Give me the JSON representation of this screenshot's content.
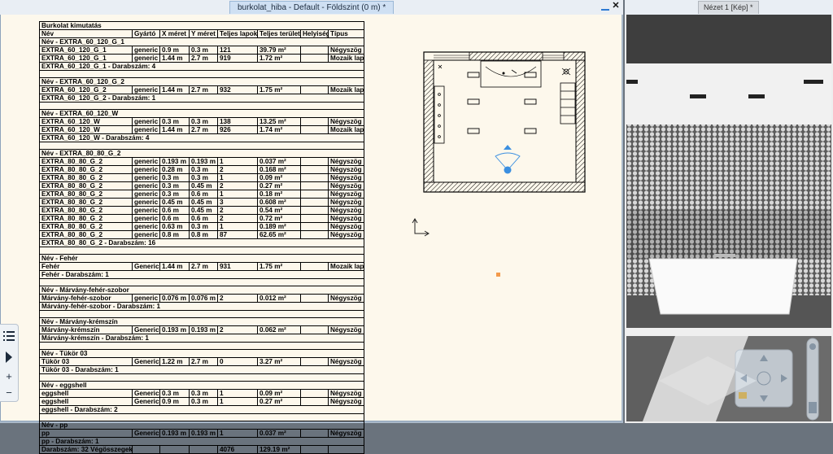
{
  "plan_window": {
    "tab_title": "burkolat_hiba - Default - Földszint (0 m) *",
    "minimize_label": "",
    "close_label": "✕"
  },
  "view_window": {
    "tab_title": "Nézet 1 [Kép] *"
  },
  "schedule": {
    "title": "Burkolat kimutatás",
    "headers": [
      "Név",
      "Gyártó",
      "X méret",
      "Y méret",
      "Teljes lapok",
      "Teljes terület",
      "Helyiség",
      "Típus"
    ],
    "rows": [
      {
        "kind": "group",
        "text": "Név - EXTRA_60_120_G_1"
      },
      {
        "kind": "data",
        "cells": [
          "EXTRA_60_120_G_1",
          "generic",
          "0.9 m",
          "0.3 m",
          "121",
          "39.79 m²",
          "",
          "Négyszög"
        ]
      },
      {
        "kind": "data",
        "cells": [
          "EXTRA_60_120_G_1",
          "generic",
          "1.44 m",
          "2.7 m",
          "919",
          "1.72 m²",
          "",
          "Mozaik lap"
        ]
      },
      {
        "kind": "summary",
        "text": "EXTRA_60_120_G_1 - Darabszám: 4"
      },
      {
        "kind": "gap"
      },
      {
        "kind": "group",
        "text": "Név - EXTRA_60_120_G_2"
      },
      {
        "kind": "data",
        "cells": [
          "EXTRA_60_120_G_2",
          "generic",
          "1.44 m",
          "2.7 m",
          "932",
          "1.75 m²",
          "",
          "Mozaik lap"
        ]
      },
      {
        "kind": "summary",
        "text": "EXTRA_60_120_G_2 - Darabszám: 1"
      },
      {
        "kind": "gap"
      },
      {
        "kind": "group",
        "text": "Név - EXTRA_60_120_W"
      },
      {
        "kind": "data",
        "cells": [
          "EXTRA_60_120_W",
          "generic",
          "0.3 m",
          "0.3 m",
          "138",
          "13.25 m²",
          "",
          "Négyszög"
        ]
      },
      {
        "kind": "data",
        "cells": [
          "EXTRA_60_120_W",
          "generic",
          "1.44 m",
          "2.7 m",
          "926",
          "1.74 m²",
          "",
          "Mozaik lap"
        ]
      },
      {
        "kind": "summary",
        "text": "EXTRA_60_120_W - Darabszám: 4"
      },
      {
        "kind": "gap"
      },
      {
        "kind": "group",
        "text": "Név - EXTRA_80_80_G_2"
      },
      {
        "kind": "data",
        "cells": [
          "EXTRA_80_80_G_2",
          "generic",
          "0.193 m",
          "0.193 m",
          "1",
          "0.037 m²",
          "",
          "Négyszög"
        ]
      },
      {
        "kind": "data",
        "cells": [
          "EXTRA_80_80_G_2",
          "generic",
          "0.28 m",
          "0.3 m",
          "2",
          "0.168 m²",
          "",
          "Négyszög"
        ]
      },
      {
        "kind": "data",
        "cells": [
          "EXTRA_80_80_G_2",
          "generic",
          "0.3 m",
          "0.3 m",
          "1",
          "0.09 m²",
          "",
          "Négyszög"
        ]
      },
      {
        "kind": "data",
        "cells": [
          "EXTRA_80_80_G_2",
          "generic",
          "0.3 m",
          "0.45 m",
          "2",
          "0.27 m²",
          "",
          "Négyszög"
        ]
      },
      {
        "kind": "data",
        "cells": [
          "EXTRA_80_80_G_2",
          "generic",
          "0.3 m",
          "0.6 m",
          "1",
          "0.18 m²",
          "",
          "Négyszög"
        ]
      },
      {
        "kind": "data",
        "cells": [
          "EXTRA_80_80_G_2",
          "generic",
          "0.45 m",
          "0.45 m",
          "3",
          "0.608 m²",
          "",
          "Négyszög"
        ]
      },
      {
        "kind": "data",
        "cells": [
          "EXTRA_80_80_G_2",
          "generic",
          "0.6 m",
          "0.45 m",
          "2",
          "0.54 m²",
          "",
          "Négyszög"
        ]
      },
      {
        "kind": "data",
        "cells": [
          "EXTRA_80_80_G_2",
          "generic",
          "0.6 m",
          "0.6 m",
          "2",
          "0.72 m²",
          "",
          "Négyszög"
        ]
      },
      {
        "kind": "data",
        "cells": [
          "EXTRA_80_80_G_2",
          "generic",
          "0.63 m",
          "0.3 m",
          "1",
          "0.189 m²",
          "",
          "Négyszög"
        ]
      },
      {
        "kind": "data",
        "cells": [
          "EXTRA_80_80_G_2",
          "generic",
          "0.8 m",
          "0.8 m",
          "87",
          "62.65 m²",
          "",
          "Négyszög"
        ]
      },
      {
        "kind": "summary",
        "text": "EXTRA_80_80_G_2 - Darabszám: 16"
      },
      {
        "kind": "gap"
      },
      {
        "kind": "group",
        "text": "Név - Fehér"
      },
      {
        "kind": "data",
        "cells": [
          "Fehér",
          "Generic",
          "1.44 m",
          "2.7 m",
          "931",
          "1.75 m²",
          "",
          "Mozaik lap"
        ]
      },
      {
        "kind": "summary",
        "text": "Fehér - Darabszám: 1"
      },
      {
        "kind": "gap"
      },
      {
        "kind": "group",
        "text": "Név - Márvány-fehér-szobor"
      },
      {
        "kind": "data",
        "cells": [
          "Márvány-fehér-szobor",
          "generic",
          "0.076 m",
          "0.076 m",
          "2",
          "0.012 m²",
          "",
          "Négyszög"
        ]
      },
      {
        "kind": "summary",
        "text": "Márvány-fehér-szobor - Darabszám: 1"
      },
      {
        "kind": "gap"
      },
      {
        "kind": "group",
        "text": "Név - Márvány-krémszín"
      },
      {
        "kind": "data",
        "cells": [
          "Márvány-krémszín",
          "Generic",
          "0.193 m",
          "0.193 m",
          "2",
          "0.062 m²",
          "",
          "Négyszög"
        ]
      },
      {
        "kind": "summary",
        "text": "Márvány-krémszín - Darabszám: 1"
      },
      {
        "kind": "gap"
      },
      {
        "kind": "group",
        "text": "Név - Tükör 03"
      },
      {
        "kind": "data",
        "cells": [
          "Tükör 03",
          "Generic",
          "1.22 m",
          "2.7 m",
          "0",
          "3.27 m²",
          "",
          "Négyszög"
        ]
      },
      {
        "kind": "summary",
        "text": "Tükör 03 - Darabszám: 1"
      },
      {
        "kind": "gap"
      },
      {
        "kind": "group",
        "text": "Név - eggshell"
      },
      {
        "kind": "data",
        "cells": [
          "eggshell",
          "Generic",
          "0.3 m",
          "0.3 m",
          "1",
          "0.09 m²",
          "",
          "Négyszög"
        ]
      },
      {
        "kind": "data",
        "cells": [
          "eggshell",
          "Generic",
          "0.9 m",
          "0.3 m",
          "1",
          "0.27 m²",
          "",
          "Négyszög"
        ]
      },
      {
        "kind": "summary",
        "text": "eggshell - Darabszám: 2"
      },
      {
        "kind": "gap"
      },
      {
        "kind": "group",
        "text": "Név - pp"
      },
      {
        "kind": "data",
        "cells": [
          "pp",
          "Generic",
          "0.193 m",
          "0.193 m",
          "1",
          "0.037 m²",
          "",
          "Négyszög"
        ]
      },
      {
        "kind": "summary",
        "text": "pp - Darabszám: 1"
      },
      {
        "kind": "total",
        "cells": [
          "Darabszám: 32 Végösszegek:",
          "",
          "",
          "",
          "4076",
          "129.19 m²",
          "",
          ""
        ]
      }
    ]
  },
  "side_toolbar": {
    "list_icon": "list-icon",
    "expand_icon": "play-icon",
    "zoom_in": "+",
    "zoom_out": "−"
  },
  "colors": {
    "window_frame": "#a9b8c9",
    "plan_background": "#fdf8ec",
    "active_tab": "#cfe0f3",
    "marker": "#f39a4b",
    "view_direction": "#3b8fe0"
  }
}
